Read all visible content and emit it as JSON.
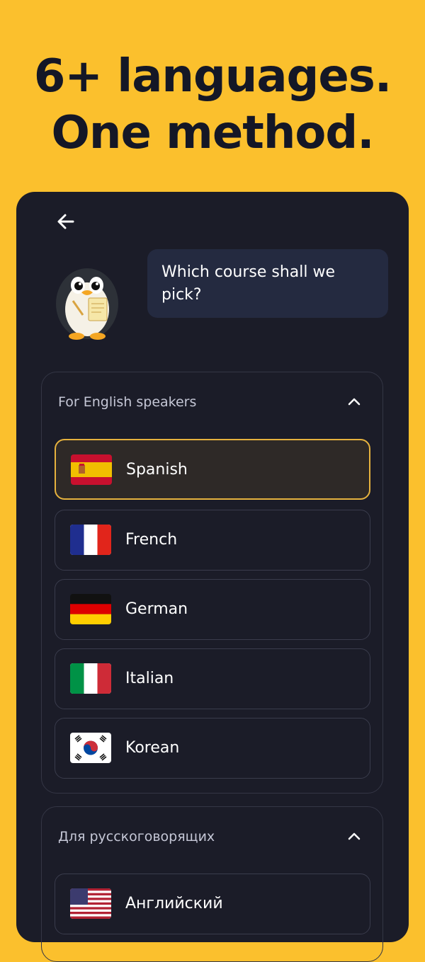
{
  "headline": {
    "line1": "6+ languages.",
    "line2": "One method."
  },
  "screen": {
    "back_icon": "arrow-left-icon",
    "mascot_icon": "penguin-mascot-icon",
    "question": "Which course shall we pick?"
  },
  "groups": [
    {
      "title": "For English speakers",
      "expanded": true,
      "items": [
        {
          "label": "Spanish",
          "flag": "spain-flag-icon",
          "selected": true
        },
        {
          "label": "French",
          "flag": "france-flag-icon",
          "selected": false
        },
        {
          "label": "German",
          "flag": "germany-flag-icon",
          "selected": false
        },
        {
          "label": "Italian",
          "flag": "italy-flag-icon",
          "selected": false
        },
        {
          "label": "Korean",
          "flag": "korea-flag-icon",
          "selected": false
        }
      ]
    },
    {
      "title": "Для русскоговорящих",
      "expanded": true,
      "items": [
        {
          "label": "Английский",
          "flag": "usa-flag-icon",
          "selected": false
        }
      ]
    }
  ],
  "colors": {
    "background": "#FBC02D",
    "panel": "#1B1C28",
    "selected_border": "#E6B23E"
  }
}
